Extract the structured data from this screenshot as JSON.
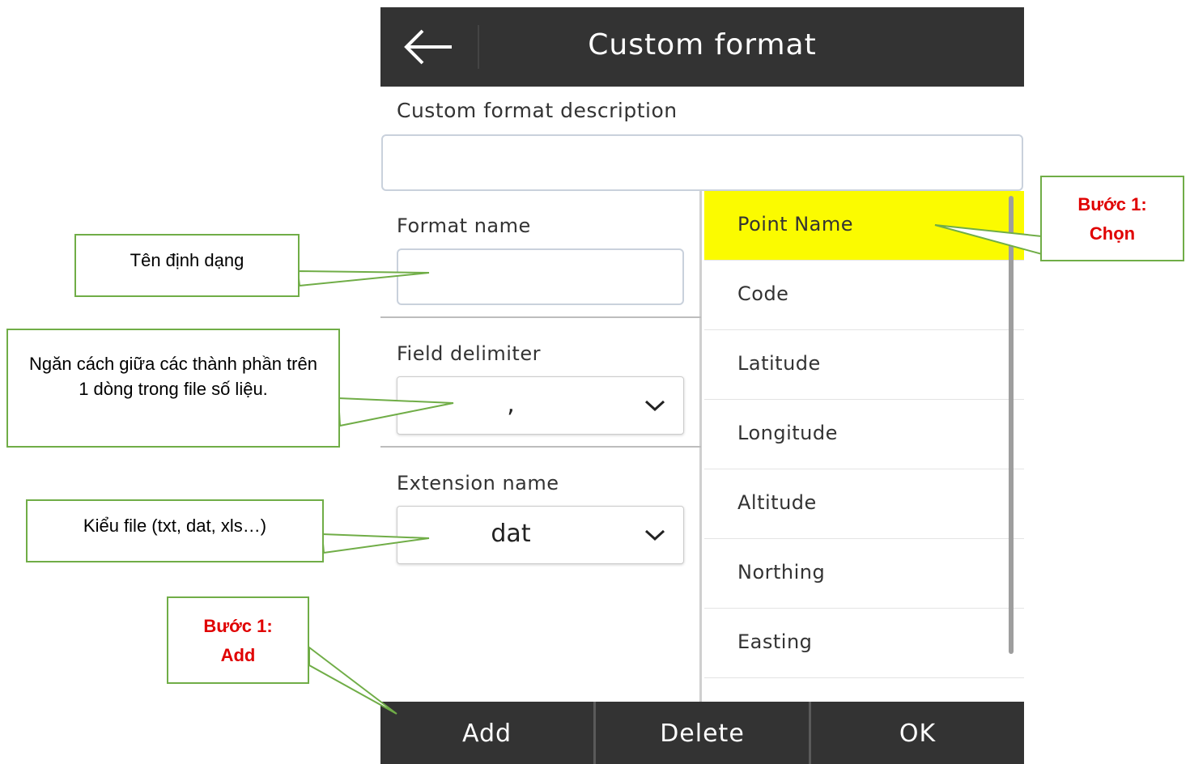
{
  "app": {
    "title": "Custom format",
    "back_icon": "arrow-left-icon"
  },
  "form": {
    "description_label": "Custom format description",
    "description_value": "",
    "format_name_label": "Format name",
    "format_name_value": "",
    "field_delimiter_label": "Field delimiter",
    "field_delimiter_value": ",",
    "extension_name_label": "Extension name",
    "extension_name_value": "dat"
  },
  "fields": {
    "selected": "Point Name",
    "items": [
      "Point Name",
      "Code",
      "Latitude",
      "Longitude",
      "Altitude",
      "Northing",
      "Easting"
    ]
  },
  "buttons": {
    "add": "Add",
    "delete": "Delete",
    "ok": "OK"
  },
  "callouts": {
    "format_name": "Tên định dạng",
    "delimiter": "Ngăn cách giữa các thành phần trên 1 dòng trong file số liệu.",
    "extension": "Kiểu file (txt, dat, xls…)",
    "step_select_line1": "Bước 1:",
    "step_select_line2": "Chọn",
    "step_add_line1": "Bước 1:",
    "step_add_line2": "Add"
  },
  "colors": {
    "bar": "#333333",
    "selected_highlight": "#fbfb00",
    "callout_border": "#70ad47",
    "callout_red_text": "#e00000"
  }
}
